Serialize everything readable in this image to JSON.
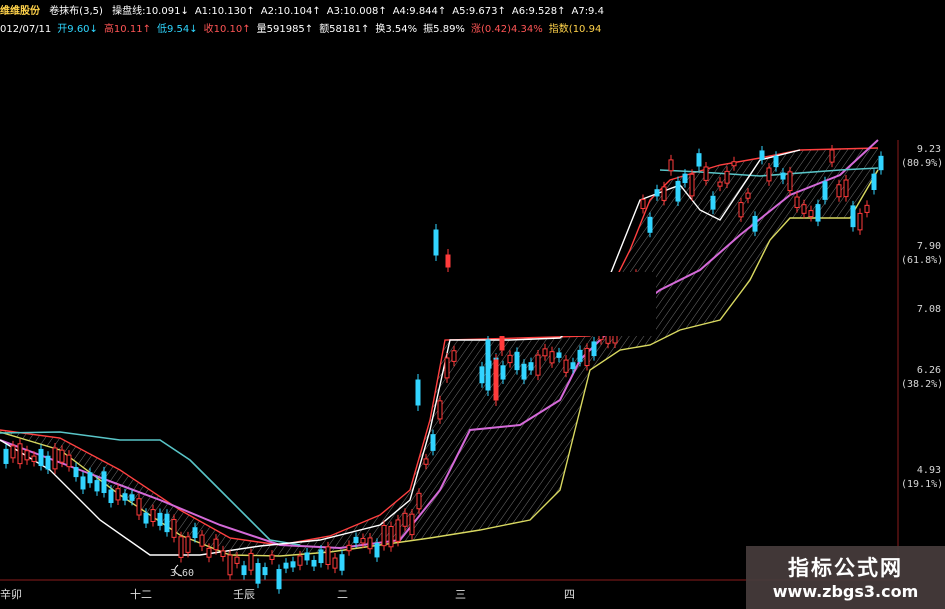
{
  "header": {
    "row1": {
      "ticker": "维维股份",
      "indicator": "卷抹布(3,5)",
      "items": [
        {
          "text": "操盘线:10.091↓",
          "color": "wh"
        },
        {
          "text": "A1:10.130↑",
          "color": "wh"
        },
        {
          "text": "A2:10.104↑",
          "color": "wh"
        },
        {
          "text": "A3:10.008↑",
          "color": "wh"
        },
        {
          "text": "A4:9.844↑",
          "color": "wh"
        },
        {
          "text": "A5:9.673↑",
          "color": "wh"
        },
        {
          "text": "A6:9.528↑",
          "color": "wh"
        },
        {
          "text": "A7:9.4",
          "color": "wh"
        }
      ]
    },
    "row2": {
      "items": [
        {
          "text": "012/07/11",
          "color": "wh"
        },
        {
          "text": "开9.60↓",
          "color": "dn"
        },
        {
          "text": "高10.11↑",
          "color": "up"
        },
        {
          "text": "低9.54↓",
          "color": "dn"
        },
        {
          "text": "收10.10↑",
          "color": "up"
        },
        {
          "text": "量591985↑",
          "color": "wh"
        },
        {
          "text": "额58181↑",
          "color": "wh"
        },
        {
          "text": "换3.54%",
          "color": "wh"
        },
        {
          "text": "振5.89%",
          "color": "wh"
        },
        {
          "text": "涨(0.42)4.34%",
          "color": "up"
        },
        {
          "text": "指数(10.94",
          "color": "yl"
        }
      ]
    }
  },
  "price_axis": [
    {
      "price": "9.23",
      "pct": "(80.9%)"
    },
    {
      "price": "7.90",
      "pct": "(61.8%)"
    },
    {
      "price": "7.08",
      "pct": ""
    },
    {
      "price": "6.26",
      "pct": "(38.2%)"
    },
    {
      "price": "4.93",
      "pct": "(19.1%)"
    }
  ],
  "low_marker": "3.60",
  "bottom_labels": [
    {
      "text": "辛卯"
    },
    {
      "text": "十二"
    },
    {
      "text": "壬辰"
    },
    {
      "text": "二"
    },
    {
      "text": "三"
    },
    {
      "text": "四"
    }
  ],
  "colors": {
    "up": "#ff3b3b",
    "down": "#32d4ff",
    "ribbon_fill": "#bdbdbd",
    "upper_edge": "#ff4040",
    "lower_edge": "#d8d860",
    "mid_line": "#d46ad8",
    "teal_line": "#59c5c8",
    "white_line": "#ffffff"
  },
  "watermark": {
    "line1": "指标公式网",
    "line2": "www.zbgs3.com"
  }
}
